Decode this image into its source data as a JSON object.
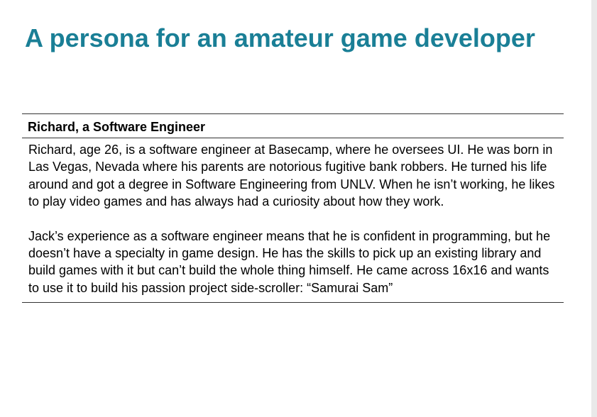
{
  "slide": {
    "title": "A persona for an amateur game developer",
    "accent_color": "#1a7f96"
  },
  "persona": {
    "heading": "Richard, a Software Engineer",
    "paragraphs": [
      "Richard, age 26, is a software engineer at Basecamp, where he oversees UI. He was born in Las Vegas, Nevada where his parents are notorious fugitive bank robbers. He turned his life around and got a degree in Software Engineering from UNLV. When he isn’t working, he likes to play video games and has always had a curiosity about how they work.",
      "Jack’s experience as a software engineer means that he is confident in programming, but he doesn’t have a specialty in game design. He has the skills to pick up an existing library and build games with it but can’t build the whole thing himself. He came across 16x16 and wants to use it to build his passion project side-scroller: “Samurai Sam”"
    ]
  }
}
